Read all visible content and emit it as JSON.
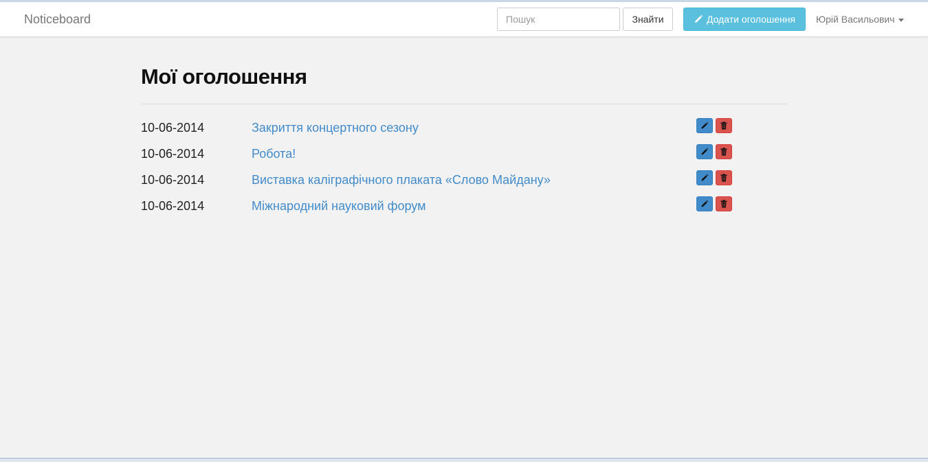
{
  "brand": "Noticeboard",
  "search": {
    "placeholder": "Пошук",
    "button_label": "Знайти"
  },
  "add_button_label": "Додати оголошення",
  "user_name": "Юрій Васильович",
  "page_title": "Мої оголошення",
  "announcements": [
    {
      "date": "10-06-2014",
      "title": "Закриття концертного сезону"
    },
    {
      "date": "10-06-2014",
      "title": "Робота!"
    },
    {
      "date": "10-06-2014",
      "title": "Виставка каліграфічного плаката «Слово Майдану»"
    },
    {
      "date": "10-06-2014",
      "title": "Міжнародний науковий форум"
    }
  ],
  "icons": {
    "add": "pencil-icon",
    "edit": "pencil-icon",
    "delete": "trash-icon",
    "user_menu": "caret-down-icon"
  },
  "colors": {
    "primary": "#428bca",
    "info": "#5bc0de",
    "danger": "#d9534f"
  }
}
